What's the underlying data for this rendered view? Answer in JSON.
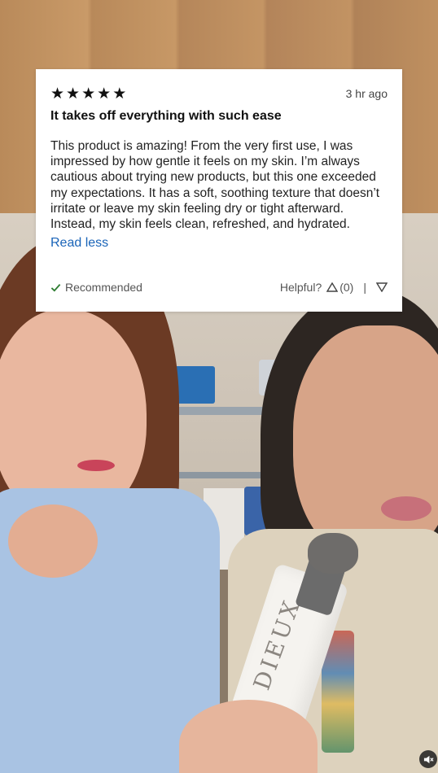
{
  "review": {
    "rating": 5,
    "stars": [
      "★",
      "★",
      "★",
      "★",
      "★"
    ],
    "time_ago": "3 hr ago",
    "title": "It takes off everything with such ease",
    "body": "This product is amazing! From the very first use, I was impressed by how gentle it feels on my skin. I’m always cautious about trying new products, but this one exceeded my expectations. It has a soft, soothing texture that doesn’t irritate or leave my skin feeling dry or tight afterward. Instead, my skin feels clean, refreshed, and hydrated.",
    "read_less_label": "Read less",
    "recommended_label": "Recommended",
    "helpful_label": "Helpful?",
    "upvote_count": "(0)",
    "separator": "|"
  },
  "scene": {
    "product_brand": "DIEUX"
  },
  "colors": {
    "link": "#1a64b8",
    "check": "#2e7d32",
    "card_bg": "#ffffff"
  },
  "icons": {
    "mute": "speaker-muted-icon"
  }
}
